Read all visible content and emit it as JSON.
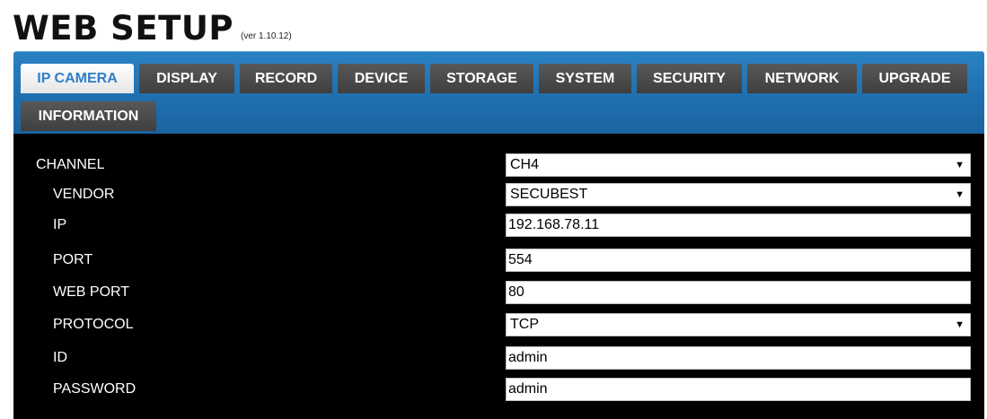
{
  "header": {
    "title": "WEB SETUP",
    "version": "(ver 1.10.12)"
  },
  "tabs": [
    {
      "label": "IP CAMERA",
      "active": true
    },
    {
      "label": "DISPLAY"
    },
    {
      "label": "RECORD"
    },
    {
      "label": "DEVICE"
    },
    {
      "label": "STORAGE"
    },
    {
      "label": "SYSTEM"
    },
    {
      "label": "SECURITY"
    },
    {
      "label": "NETWORK"
    },
    {
      "label": "UPGRADE"
    },
    {
      "label": "INFORMATION"
    }
  ],
  "colors": {
    "tab_bar": "#1f6fae",
    "tab_inactive": "#4a4a4a",
    "tab_active_text": "#2f7fc8",
    "panel_bg": "#000000"
  },
  "form": {
    "channel": {
      "label": "CHANNEL",
      "value": "CH4"
    },
    "vendor": {
      "label": "VENDOR",
      "value": "SECUBEST"
    },
    "ip": {
      "label": "IP",
      "value": "192.168.78.11"
    },
    "port": {
      "label": "PORT",
      "value": "554"
    },
    "web_port": {
      "label": "WEB PORT",
      "value": "80"
    },
    "protocol": {
      "label": "PROTOCOL",
      "value": "TCP"
    },
    "id": {
      "label": "ID",
      "value": "admin"
    },
    "password": {
      "label": "PASSWORD",
      "value": "admin"
    }
  },
  "icons": {
    "dropdown": "chevron-down-icon"
  }
}
